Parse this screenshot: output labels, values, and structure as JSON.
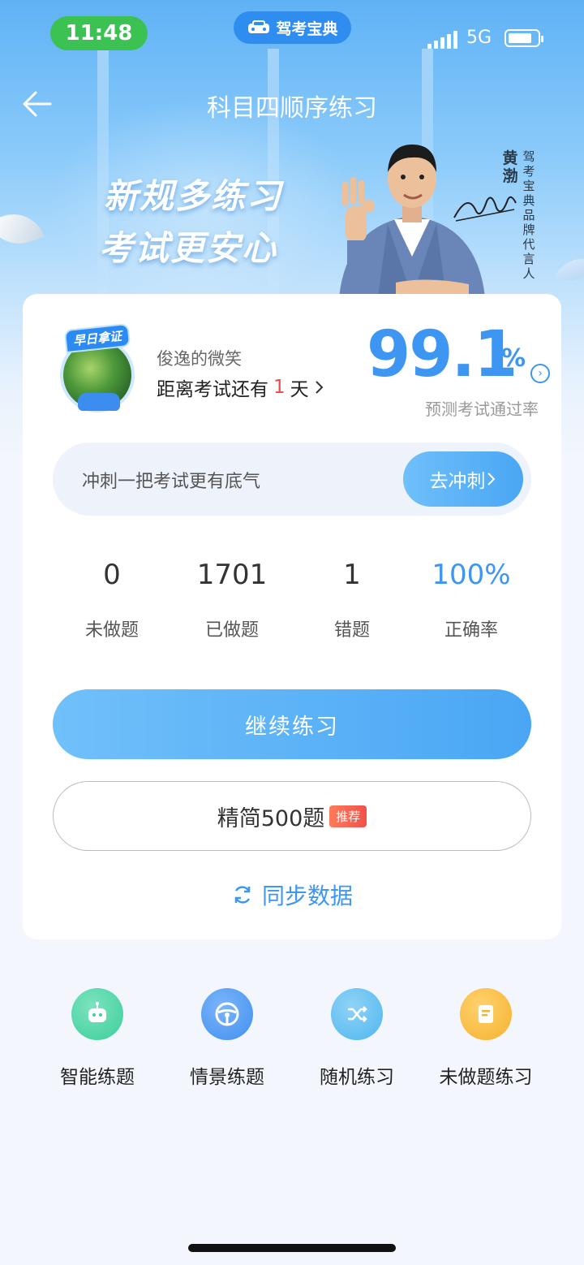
{
  "status_bar": {
    "time": "11:48",
    "network": "5G"
  },
  "brand": {
    "name": "驾考宝典"
  },
  "header": {
    "title": "科目四顺序练习"
  },
  "banner": {
    "slogan_line1": "新规多练习",
    "slogan_line2": "考试更安心",
    "spokesperson_name": "黄渤",
    "spokesperson_title": "驾考宝典品牌代言人"
  },
  "profile": {
    "avatar_badge": "早日拿证",
    "username": "俊逸的微笑",
    "countdown_prefix": "距离考试还有",
    "countdown_days": "1",
    "countdown_suffix": "天"
  },
  "pass_rate": {
    "value": "99.1",
    "unit": "%",
    "label": "预测考试通过率"
  },
  "sprint": {
    "text": "冲刺一把考试更有底气",
    "button": "去冲刺"
  },
  "stats": [
    {
      "value": "0",
      "label": "未做题"
    },
    {
      "value": "1701",
      "label": "已做题"
    },
    {
      "value": "1",
      "label": "错题"
    },
    {
      "value": "100%",
      "label": "正确率"
    }
  ],
  "actions": {
    "continue": "继续练习",
    "simplified": "精简500题",
    "recommend_badge": "推荐",
    "sync": "同步数据"
  },
  "features": [
    {
      "label": "智能练题",
      "icon": "robot-icon",
      "color": "#3ccf9a"
    },
    {
      "label": "情景练题",
      "icon": "steering-wheel-icon",
      "color": "#3f8ff0"
    },
    {
      "label": "随机练习",
      "icon": "shuffle-icon",
      "color": "#4fb6ee"
    },
    {
      "label": "未做题练习",
      "icon": "document-icon",
      "color": "#f5b12e"
    }
  ],
  "colors": {
    "accent": "#3d96f2",
    "countdown_highlight": "#f04848",
    "status_pill": "#3cc253"
  }
}
